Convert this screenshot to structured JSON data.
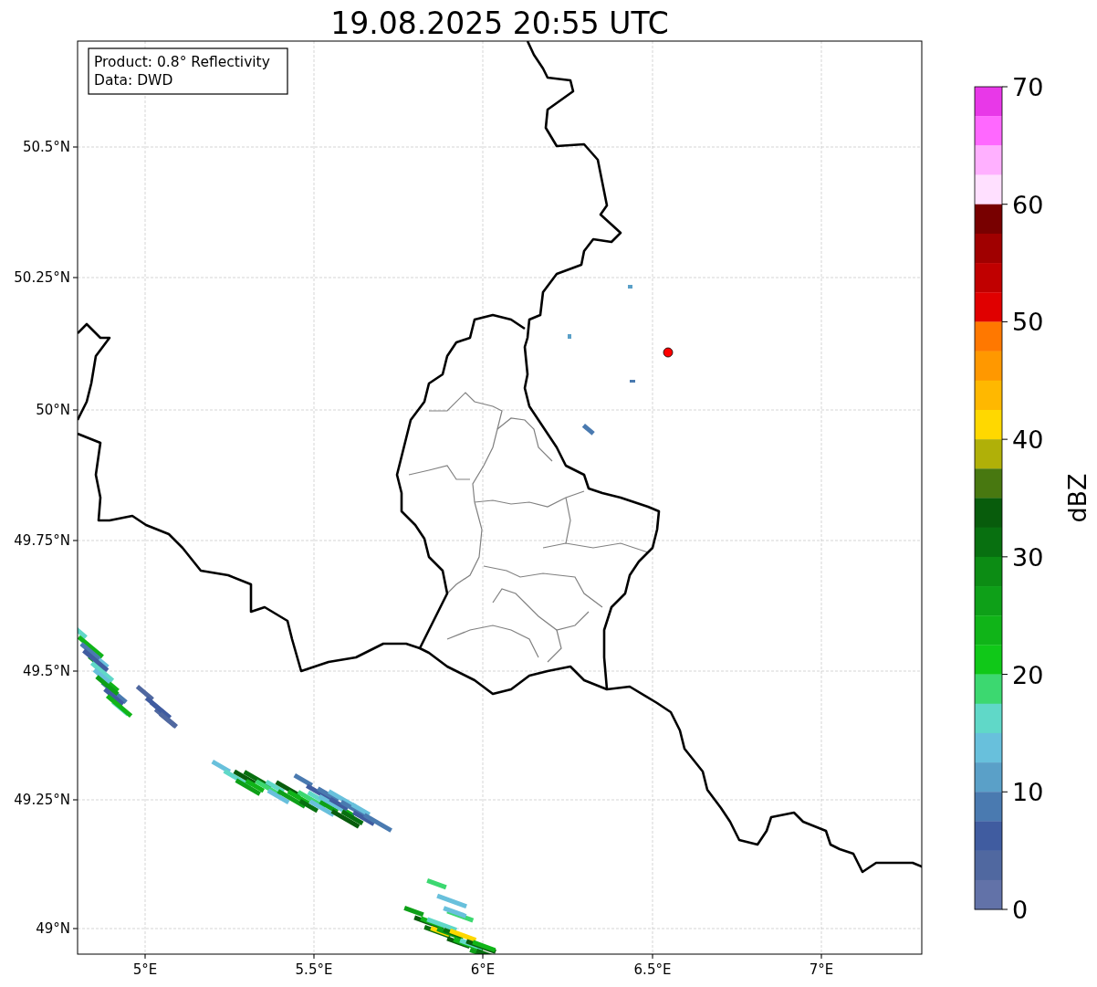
{
  "title": "19.08.2025 20:55 UTC",
  "info_box": {
    "lines": [
      "Product: 0.8° Reflectivity",
      "Data: DWD"
    ]
  },
  "map": {
    "yticks": [
      "50.5°N",
      "50.25°N",
      "50°N",
      "49.75°N",
      "49.5°N",
      "49.25°N",
      "49°N"
    ],
    "xticks": [
      "5°E",
      "5.5°E",
      "6°E",
      "6.5°E",
      "7°E"
    ]
  },
  "colorbar": {
    "label": "dBZ",
    "ticks": [
      "70",
      "60",
      "50",
      "40",
      "30",
      "20",
      "10",
      "0"
    ],
    "segments": [
      {
        "color": "#e838e8"
      },
      {
        "color": "#ff68ff"
      },
      {
        "color": "#ffb0ff"
      },
      {
        "color": "#ffe0ff"
      },
      {
        "color": "#780000"
      },
      {
        "color": "#a00000"
      },
      {
        "color": "#c00000"
      },
      {
        "color": "#e00000"
      },
      {
        "color": "#ff7800"
      },
      {
        "color": "#ff9800"
      },
      {
        "color": "#ffb800"
      },
      {
        "color": "#ffd800"
      },
      {
        "color": "#b0b008"
      },
      {
        "color": "#487810"
      },
      {
        "color": "#085c0c"
      },
      {
        "color": "#087010"
      },
      {
        "color": "#0c8c14"
      },
      {
        "color": "#0ea018"
      },
      {
        "color": "#10b418"
      },
      {
        "color": "#10c818"
      },
      {
        "color": "#3cd870"
      },
      {
        "color": "#60d8c8"
      },
      {
        "color": "#68c0dc"
      },
      {
        "color": "#5aa0c8"
      },
      {
        "color": "#4a7ab0"
      },
      {
        "color": "#405ca0"
      },
      {
        "color": "#5068a0"
      },
      {
        "color": "#6272a8"
      }
    ]
  }
}
